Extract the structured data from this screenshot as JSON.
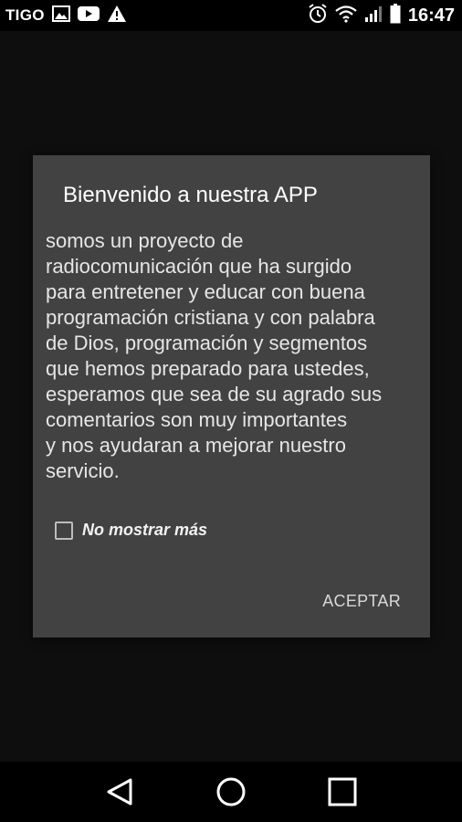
{
  "status_bar": {
    "carrier": "TIGO",
    "time": "16:47",
    "icons": [
      "image-icon",
      "youtube-icon",
      "warning-icon",
      "alarm-icon",
      "wifi-icon",
      "signal-icon",
      "battery-icon"
    ]
  },
  "dialog": {
    "title": "Bienvenido a nuestra APP",
    "message": "somos un proyecto de\nradiocomunicación que ha surgido\npara entretener y educar con buena\nprogramación cristiana y con palabra\nde Dios, programación y segmentos\nque hemos preparado para ustedes,\nesperamos que sea de su agrado sus\ncomentarios son muy importantes\ny nos ayudaran a mejorar nuestro\nservicio.",
    "checkbox": {
      "label": "No mostrar más",
      "checked": false
    },
    "accept_label": "ACEPTAR"
  },
  "nav_bar": {
    "buttons": [
      "back-icon",
      "home-icon",
      "recents-icon"
    ]
  },
  "colors": {
    "dialog_bg": "#424242",
    "screen_bg": "#0e0e0e",
    "bar_bg": "#000000"
  }
}
